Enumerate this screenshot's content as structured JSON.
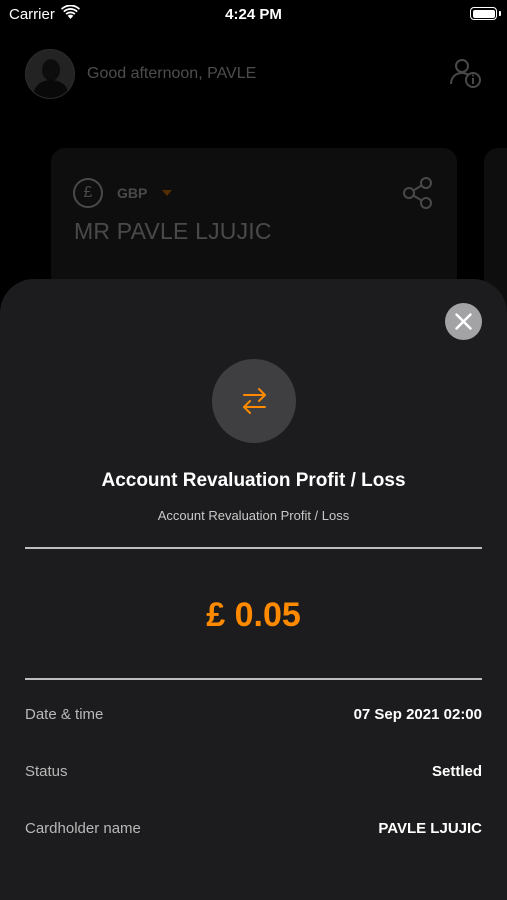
{
  "status_bar": {
    "carrier": "Carrier",
    "time": "4:24 PM"
  },
  "home": {
    "greeting": "Good afternoon, PAVLE",
    "card": {
      "currency_symbol": "£",
      "currency_code": "GBP",
      "holder_name": "MR PAVLE LJUJIC"
    }
  },
  "transaction": {
    "title": "Account Revaluation Profit / Loss",
    "description": "Account Revaluation Profit / Loss",
    "amount": "£ 0.05",
    "details": [
      {
        "label": "Date & time",
        "value": "07 Sep 2021 02:00"
      },
      {
        "label": "Status",
        "value": "Settled"
      },
      {
        "label": "Cardholder name",
        "value": "PAVLE LJUJIC"
      }
    ]
  },
  "colors": {
    "accent": "#ff8a00",
    "sheet_background": "#1c1c1e",
    "background": "#000000"
  },
  "icons": {
    "wifi": "wifi-icon",
    "battery": "battery-icon",
    "profile_info": "profile-info-icon",
    "share": "share-icon",
    "close": "close-icon",
    "transfer": "transfer-arrows-icon"
  }
}
